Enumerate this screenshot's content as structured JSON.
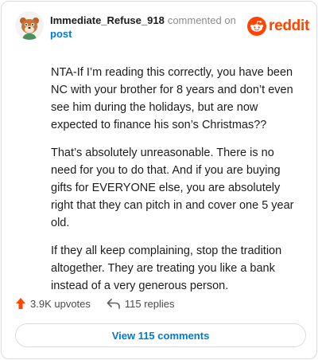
{
  "header": {
    "author": "Immediate_Refuse_918",
    "action": "commented on",
    "target": "post",
    "brand": "reddit"
  },
  "comment": {
    "paragraphs": [
      "NTA-If I’m reading this correctly, you have been NC with your brother for 8 years and don’t even see him during the holidays, but are now expected to finance his son’s Christmas??",
      "That’s absolutely unreasonable. There is no need for you to do that. And if you are buying gifts for EVERYONE else, you are absolutely right that they can pitch in and cover one 5 year old.",
      "If they all keep complaining, stop the tradition altogether. They are treating you like a bank instead of a very generous person."
    ]
  },
  "stats": {
    "upvotes": "3.9K upvotes",
    "replies": "115 replies"
  },
  "footer": {
    "view_label": "View 115 comments"
  },
  "colors": {
    "brand": "#ff4500",
    "link": "#0079d3",
    "upvote": "#ff4500"
  },
  "icons": [
    "avatar",
    "reddit-logo-icon",
    "upvote-arrow-icon",
    "reply-arrow-icon"
  ]
}
